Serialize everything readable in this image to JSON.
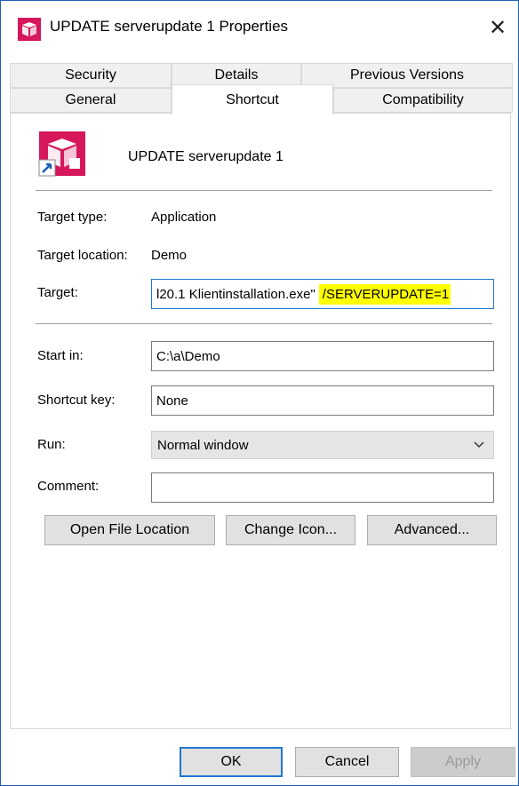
{
  "window": {
    "title": "UPDATE serverupdate 1 Properties",
    "close_icon": "✕"
  },
  "tabs": {
    "row1": [
      "Security",
      "Details",
      "Previous Versions"
    ],
    "row2": [
      "General",
      "Shortcut",
      "Compatibility"
    ],
    "active": "Shortcut"
  },
  "shortcut": {
    "name": "UPDATE serverupdate 1",
    "target_type_label": "Target type:",
    "target_type_value": "Application",
    "target_location_label": "Target location:",
    "target_location_value": "Demo",
    "target_label": "Target:",
    "target_value_visible": "l20.1 Klientinstallation.exe\"",
    "target_value_highlight": "/SERVERUPDATE=1",
    "start_in_label": "Start in:",
    "start_in_value": "C:\\a\\Demo",
    "shortcut_key_label": "Shortcut key:",
    "shortcut_key_value": "None",
    "run_label": "Run:",
    "run_value": "Normal window",
    "comment_label": "Comment:",
    "comment_value": ""
  },
  "buttons": {
    "open_file_location": "Open File Location",
    "change_icon": "Change Icon...",
    "advanced": "Advanced...",
    "ok": "OK",
    "cancel": "Cancel",
    "apply": "Apply"
  },
  "colors": {
    "accent": "#1f78d1",
    "icon_brand": "#d6175b",
    "highlight": "#ffff00"
  }
}
